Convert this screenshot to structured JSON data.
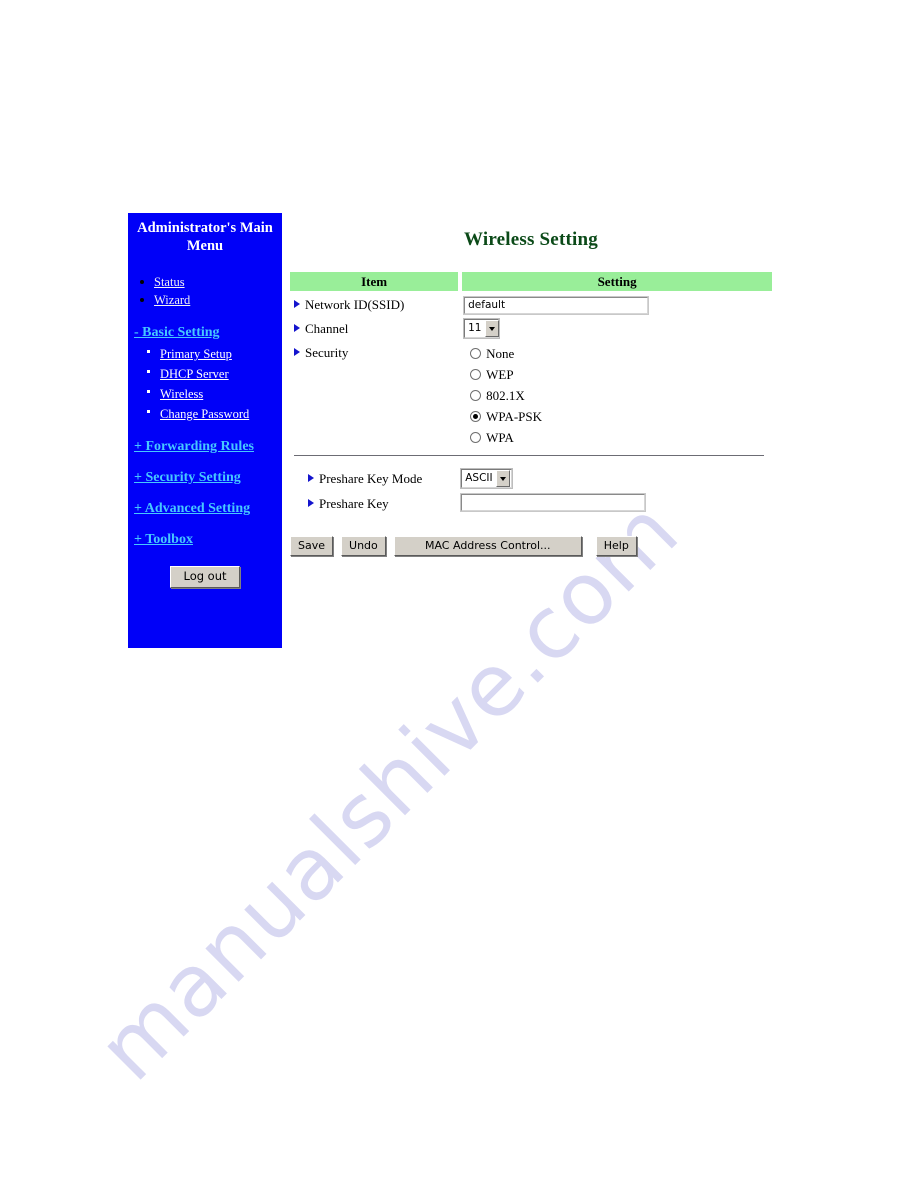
{
  "watermark": {
    "text": "manualshive.com",
    "color": "#d8d8f2"
  },
  "sidebar": {
    "title": "Administrator's Main Menu",
    "background": "#0000f8",
    "top_links": [
      {
        "label": "Status"
      },
      {
        "label": "Wizard"
      }
    ],
    "basic_setting": {
      "label": "- Basic Setting",
      "items": [
        {
          "label": "Primary Setup"
        },
        {
          "label": "DHCP Server"
        },
        {
          "label": "Wireless"
        },
        {
          "label": "Change Password"
        }
      ]
    },
    "collapsed_sections": [
      {
        "label": "+ Forwarding Rules"
      },
      {
        "label": "+ Security Setting"
      },
      {
        "label": "+ Advanced Setting"
      },
      {
        "label": "+ Toolbox"
      }
    ],
    "logout_label": "Log out"
  },
  "main": {
    "heading": "Wireless Setting",
    "table": {
      "header_color": "#99ee99",
      "columns": [
        "Item",
        "Setting"
      ],
      "rows": [
        {
          "label": "Network ID(SSID)",
          "type": "text",
          "value": "default"
        },
        {
          "label": "Channel",
          "type": "select",
          "value": "11"
        },
        {
          "label": "Security",
          "type": "radio"
        }
      ]
    },
    "security_options": [
      {
        "label": "None",
        "checked": false
      },
      {
        "label": "WEP",
        "checked": false
      },
      {
        "label": "802.1X",
        "checked": false
      },
      {
        "label": "WPA-PSK",
        "checked": true
      },
      {
        "label": "WPA",
        "checked": false
      }
    ],
    "preshare": {
      "mode_label": "Preshare Key Mode",
      "mode_value": "ASCII",
      "key_label": "Preshare Key",
      "key_value": "",
      "key_placeholder": ""
    },
    "buttons": {
      "save": "Save",
      "undo": "Undo",
      "mac": "MAC Address Control...",
      "help": "Help"
    }
  }
}
